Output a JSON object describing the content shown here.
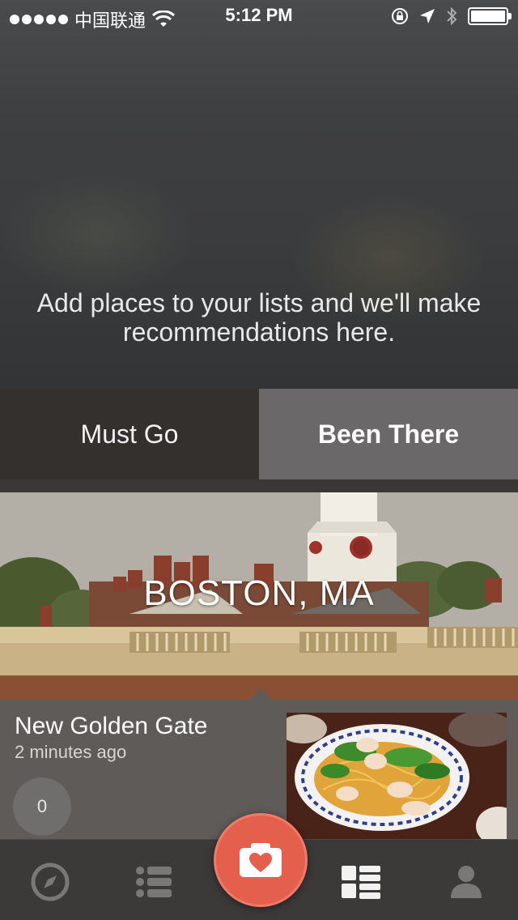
{
  "status_bar": {
    "carrier": "中国联通",
    "time": "5:12 PM",
    "icons": [
      "signal-dots-icon",
      "wifi-icon",
      "rotation-lock-icon",
      "location-arrow-icon",
      "bluetooth-icon",
      "battery-icon"
    ]
  },
  "hero": {
    "message": "Add places to your lists and we'll make recommendations here."
  },
  "tabs": [
    {
      "label": "Must Go",
      "selected": false
    },
    {
      "label": "Been There",
      "selected": true
    }
  ],
  "city_card": {
    "title": "BOSTON, MA"
  },
  "post": {
    "place_name": "New Golden Gate",
    "time_ago": "2 minutes ago",
    "like_count": "0"
  },
  "tabbar": {
    "items": [
      "compass-icon",
      "list-icon",
      "camera-heart-icon",
      "grid-list-icon",
      "profile-icon"
    ],
    "selected": "grid-list-icon"
  },
  "colors": {
    "accent": "#e4604d",
    "selected_tab_bg": "#6a6868",
    "unselected_tab_bg": "#33302e"
  }
}
